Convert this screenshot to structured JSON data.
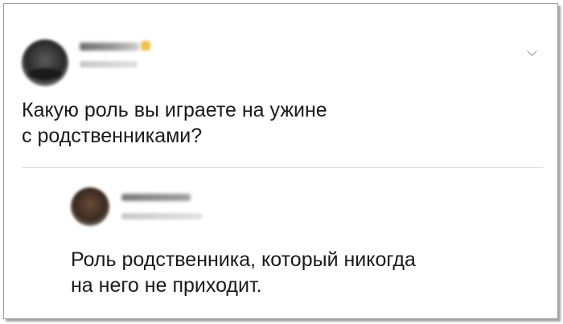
{
  "post": {
    "avatar_icon": "user-avatar-icon",
    "menu_icon": "chevron-down-icon",
    "text_line1": "Какую роль вы играете на ужине",
    "text_line2": "с родственниками?"
  },
  "reply": {
    "avatar_icon": "user-avatar-icon",
    "text_line1": "Роль родственника, который никогда",
    "text_line2": "на него не приходит."
  },
  "colors": {
    "text": "#1a1a1a",
    "divider": "#dddddd",
    "frame_border": "#9a9a9a",
    "badge": "#f0c050"
  }
}
